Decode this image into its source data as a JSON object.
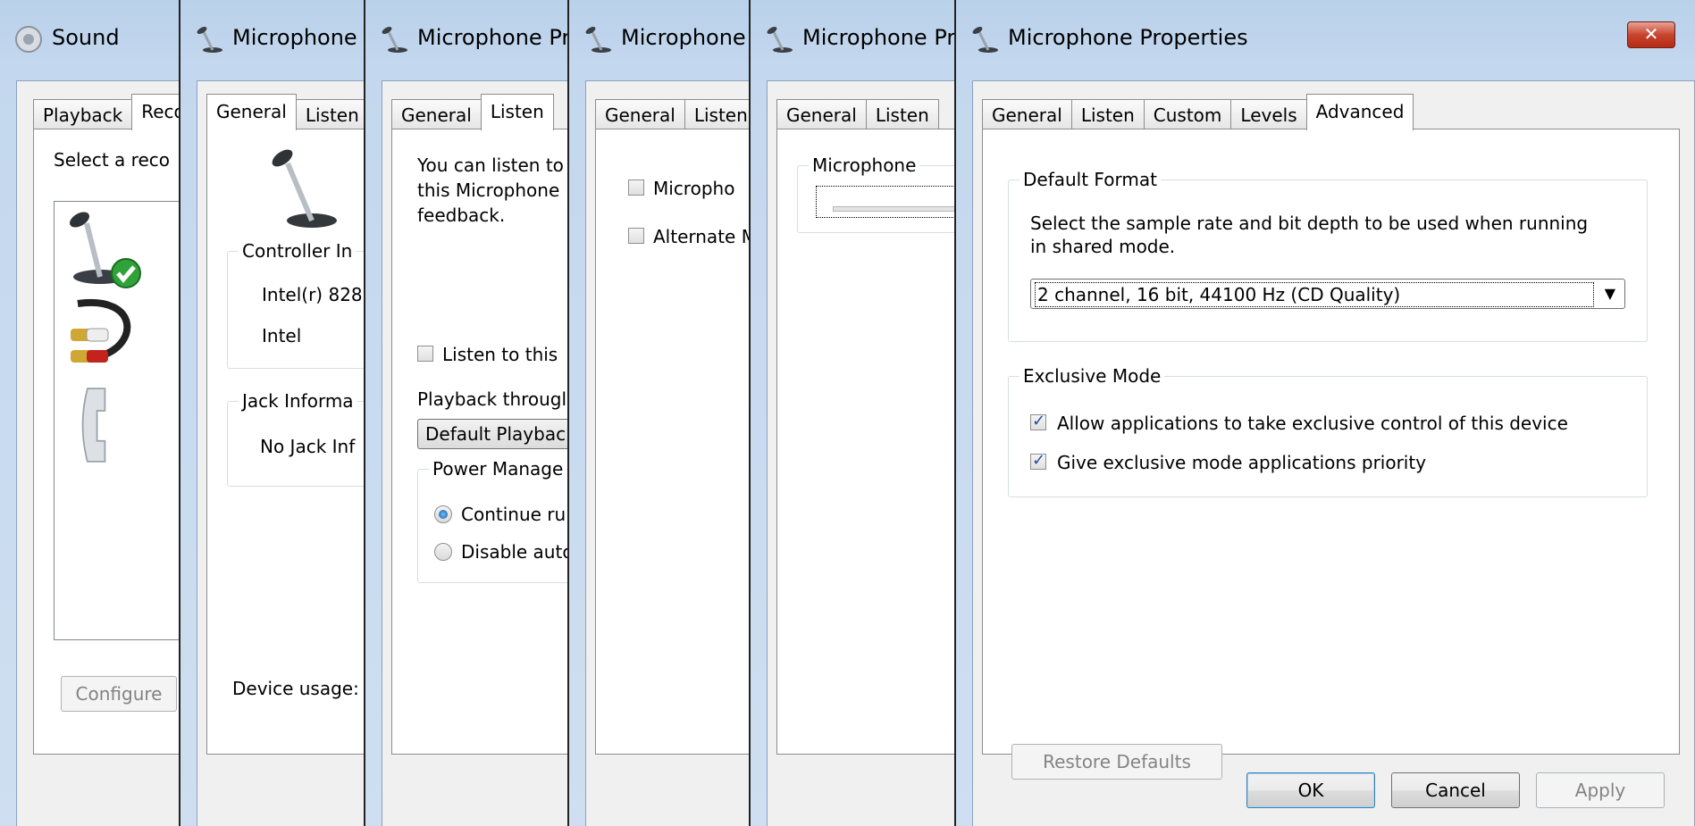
{
  "windows": [
    {
      "title": "Sound",
      "tabs": [
        "Playback",
        "Reco"
      ],
      "active_tab": 1,
      "prompt": "Select a reco",
      "configure_label": "Configure"
    },
    {
      "title": "Microphone P",
      "tabs": [
        "General",
        "Listen"
      ],
      "active_tab": 0,
      "controller_group": "Controller In",
      "controller_name": "Intel(r) 828",
      "controller_vendor": "Intel",
      "jack_group": "Jack Informa",
      "jack_info": "No Jack Inf",
      "device_usage": "Device usage:"
    },
    {
      "title": "Microphone Pro",
      "tabs": [
        "General",
        "Listen"
      ],
      "active_tab": 1,
      "desc_line1": "You can listen to",
      "desc_line2": "this Microphone",
      "desc_line3": "feedback.",
      "listen_checkbox": "Listen to this",
      "playback_label": "Playback througl",
      "playback_value": "Default Playbacl",
      "power_group": "Power Manage",
      "radio_continue": "Continue ru",
      "radio_disable": "Disable auto"
    },
    {
      "title": "Microphone P",
      "tabs": [
        "General",
        "Listen"
      ],
      "active_tab": -1,
      "cb_microphone": "Micropho",
      "cb_alternate": "Alternate M"
    },
    {
      "title": "Microphone Pro",
      "tabs": [
        "General",
        "Listen"
      ],
      "active_tab": -1,
      "levels_group": "Microphone"
    },
    {
      "title": "Microphone Properties",
      "tabs": [
        "General",
        "Listen",
        "Custom",
        "Levels",
        "Advanced"
      ],
      "active_tab": 4,
      "default_format_group": "Default Format",
      "format_desc_line1": "Select the sample rate and bit depth to be used when running",
      "format_desc_line2": "in shared mode.",
      "format_value": "2 channel, 16 bit, 44100 Hz (CD Quality)",
      "exclusive_group": "Exclusive Mode",
      "allow_exclusive": "Allow applications to take exclusive control of this device",
      "allow_exclusive_checked": true,
      "give_priority": "Give exclusive mode applications priority",
      "give_priority_checked": true,
      "restore_defaults": "Restore Defaults",
      "ok": "OK",
      "cancel": "Cancel",
      "apply": "Apply",
      "close_glyph": "✕"
    }
  ]
}
